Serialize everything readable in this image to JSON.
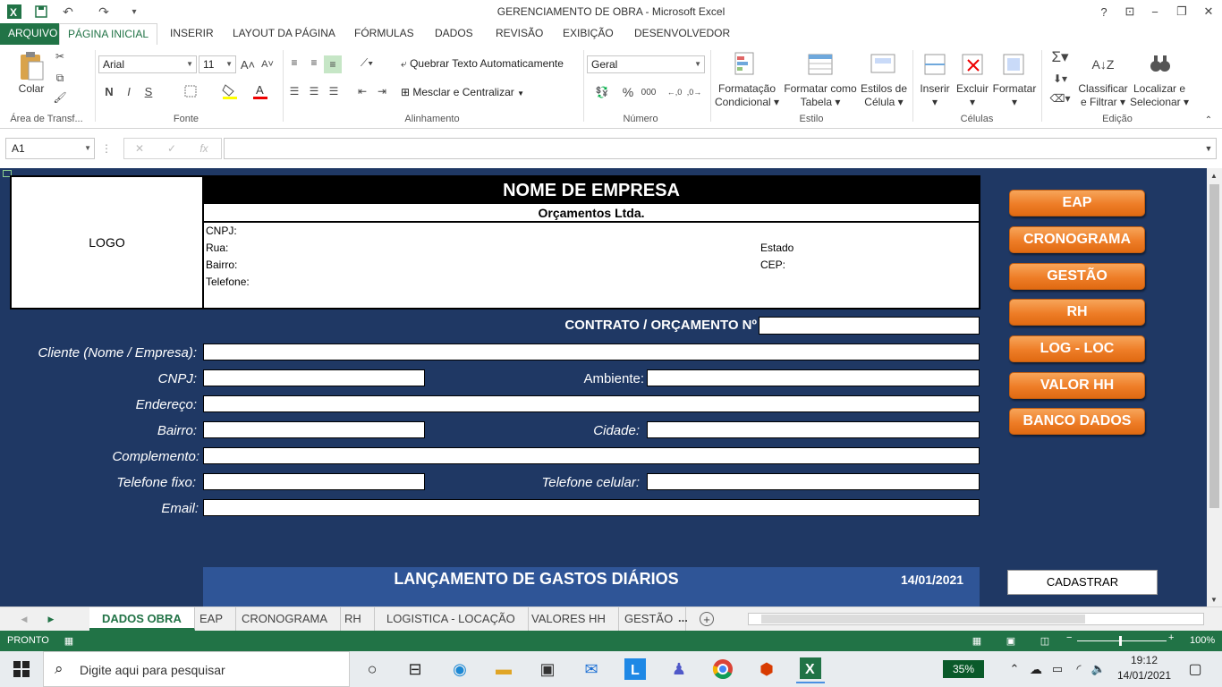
{
  "app": {
    "title": "GERENCIAMENTO DE OBRA - Microsoft Excel",
    "help": "?",
    "min": "−",
    "restore": "❐",
    "close": "✕"
  },
  "ribbon_tabs": [
    "ARQUIVO",
    "PÁGINA INICIAL",
    "INSERIR",
    "LAYOUT DA PÁGINA",
    "FÓRMULAS",
    "DADOS",
    "REVISÃO",
    "EXIBIÇÃO",
    "DESENVOLVEDOR"
  ],
  "clipboard": {
    "paste": "Colar",
    "group": "Área de Transf..."
  },
  "font": {
    "name": "Arial",
    "size": "11",
    "bold": "N",
    "italic": "I",
    "underline": "S",
    "group": "Fonte"
  },
  "alignment": {
    "wrap": "Quebrar Texto Automaticamente",
    "merge": "Mesclar e Centralizar",
    "group": "Alinhamento"
  },
  "number": {
    "format": "Geral",
    "percent": "%",
    "thousands": "000",
    "group": "Número"
  },
  "styles": {
    "cond1": "Formatação",
    "cond2": "Condicional",
    "table1": "Formatar como",
    "table2": "Tabela",
    "cell1": "Estilos de",
    "cell2": "Célula",
    "group": "Estilo"
  },
  "cells": {
    "insert": "Inserir",
    "delete": "Excluir",
    "format": "Formatar",
    "group": "Células"
  },
  "editing": {
    "sort1": "Classificar",
    "sort2": "e Filtrar",
    "find1": "Localizar e",
    "find2": "Selecionar",
    "group": "Edição"
  },
  "formula_bar": {
    "name_box": "A1",
    "fx": "fx"
  },
  "sheet": {
    "logo": "LOGO",
    "company": "NOME DE EMPRESA",
    "subtitle": "Orçamentos Ltda.",
    "cnpj": "CNPJ:",
    "rua": "Rua:",
    "bairro": "Bairro:",
    "telefone": "Telefone:",
    "estado": "Estado",
    "cep": "CEP:",
    "contract": "CONTRATO / ORÇAMENTO Nº",
    "labels": {
      "cliente": "Cliente (Nome / Empresa):",
      "cnpj": "CNPJ:",
      "ambiente": "Ambiente:",
      "endereco": "Endereço:",
      "bairro": "Bairro:",
      "cidade": "Cidade:",
      "complemento": "Complemento:",
      "telfixo": "Telefone fixo:",
      "telcel": "Telefone celular:",
      "email": "Email:"
    },
    "gastos_title": "LANÇAMENTO DE GASTOS DIÁRIOS",
    "gastos_date": "14/01/2021",
    "cadastrar": "CADASTRAR",
    "nav": [
      "EAP",
      "CRONOGRAMA",
      "GESTÃO",
      "RH",
      "LOG - LOC",
      "VALOR HH",
      "BANCO DADOS"
    ]
  },
  "sheet_tabs": [
    "DADOS OBRA",
    "EAP",
    "CRONOGRAMA",
    "RH",
    "LOGISTICA - LOCAÇÃO",
    "VALORES HH",
    "GESTÃO",
    "..."
  ],
  "status": {
    "ready": "PRONTO",
    "zoom": "100%"
  },
  "taskbar": {
    "search": "Digite aqui para pesquisar",
    "battery": "35%",
    "time": "19:12",
    "date": "14/01/2021"
  },
  "colors": {
    "excel_green": "#217346",
    "sheet_bg": "#1f3864",
    "button_orange": "#ee7d27"
  }
}
